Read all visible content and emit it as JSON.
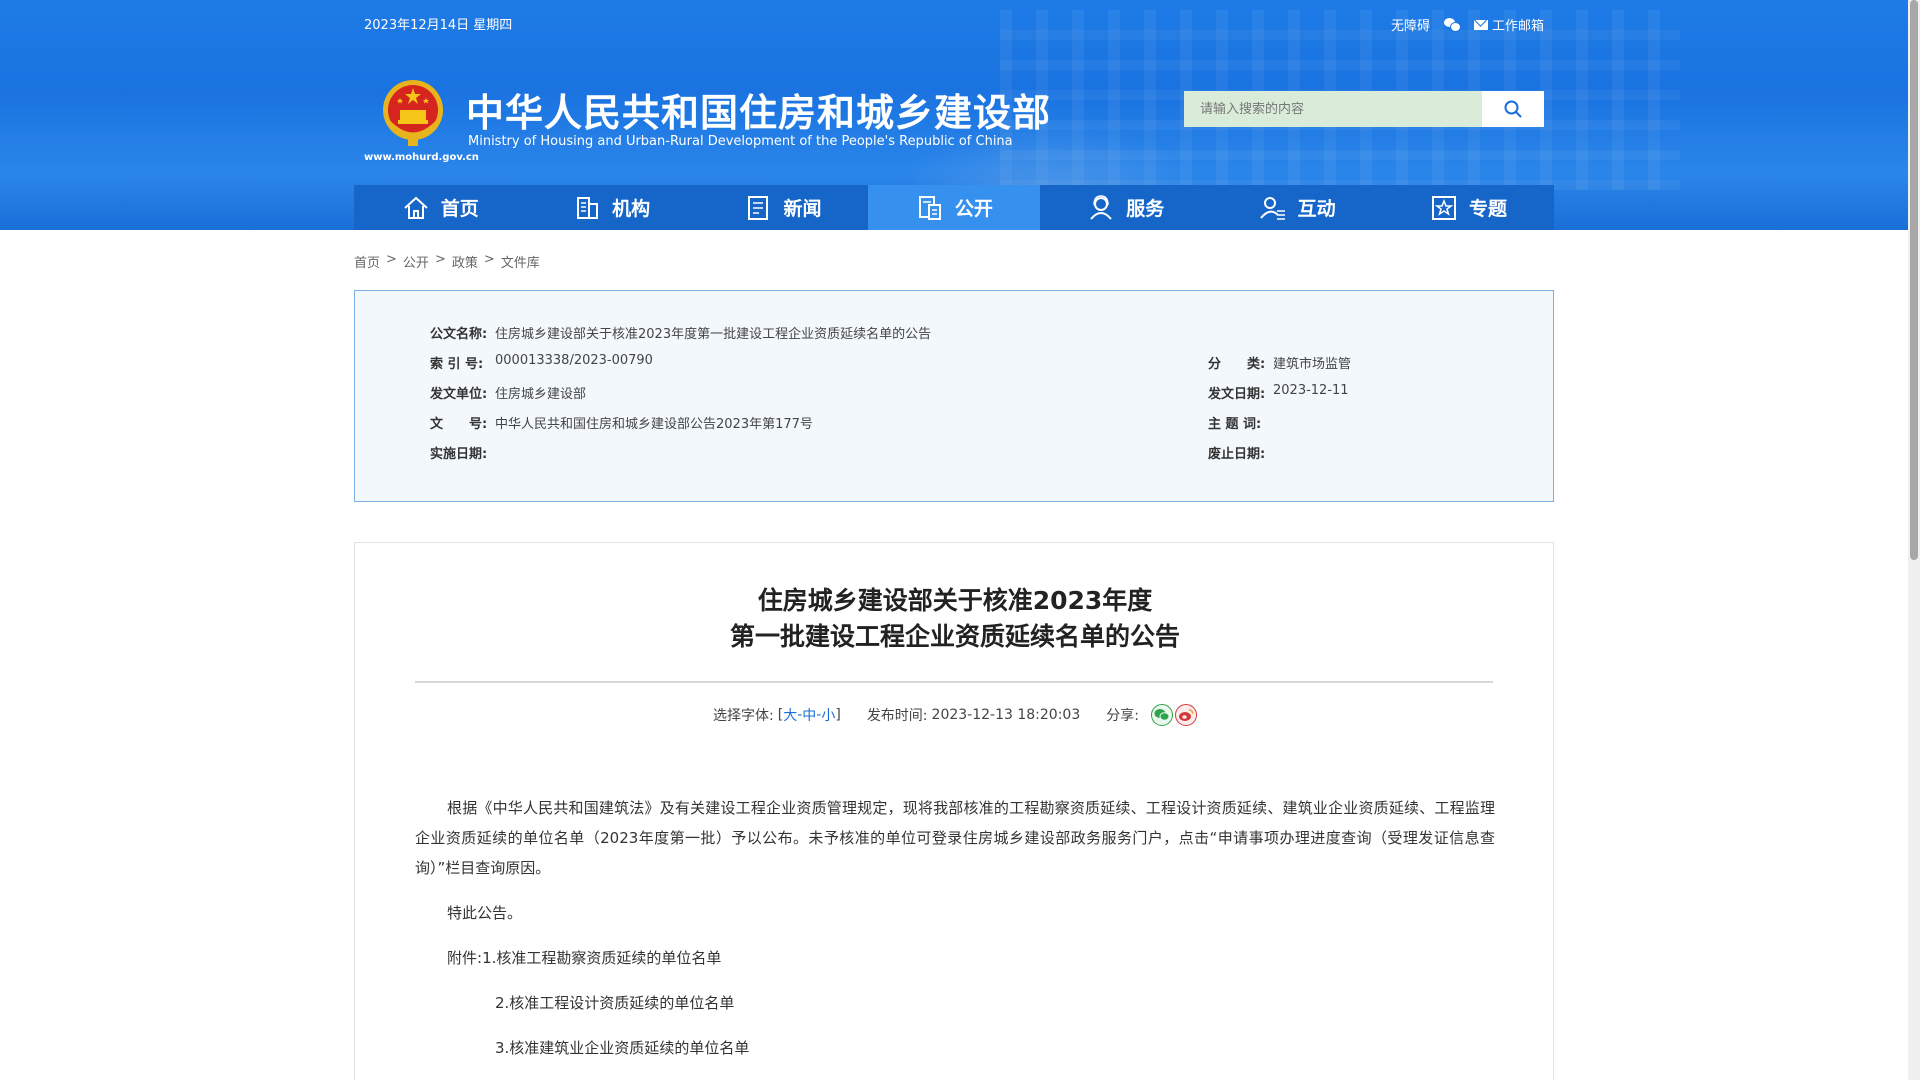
{
  "topbar": {
    "date": "2023年12月14日 星期四",
    "accessibility": "无障碍",
    "work_mail": "工作邮箱"
  },
  "site": {
    "title_cn": "中华人民共和国住房和城乡建设部",
    "title_en": "Ministry of Housing and Urban-Rural Development of the People's Republic of China",
    "url": "www.mohurd.gov.cn"
  },
  "search": {
    "placeholder": "请输入搜索的内容"
  },
  "nav": {
    "items": [
      {
        "label": "首页",
        "icon": "home-icon"
      },
      {
        "label": "机构",
        "icon": "building-icon"
      },
      {
        "label": "新闻",
        "icon": "news-icon"
      },
      {
        "label": "公开",
        "icon": "disclosure-icon"
      },
      {
        "label": "服务",
        "icon": "service-icon"
      },
      {
        "label": "互动",
        "icon": "interaction-icon"
      },
      {
        "label": "专题",
        "icon": "topic-icon"
      }
    ],
    "active": "公开"
  },
  "breadcrumb": {
    "items": [
      "首页",
      "公开",
      "政策",
      "文件库"
    ],
    "sep": ">"
  },
  "info": {
    "doc_name_label": "公文名称:",
    "doc_name": "住房城乡建设部关于核准2023年度第一批建设工程企业资质延续名单的公告",
    "index_label": "索 引 号:",
    "index": "000013338/2023-00790",
    "category_label": "分　　类:",
    "category": "建筑市场监管",
    "issuer_label": "发文单位:",
    "issuer": "住房城乡建设部",
    "issue_date_label": "发文日期:",
    "issue_date": "2023-12-11",
    "doc_no_label": "文　　号:",
    "doc_no": "中华人民共和国住房和城乡建设部公告2023年第177号",
    "subject_label": "主 题 词:",
    "subject": "",
    "effective_label": "实施日期:",
    "effective": "",
    "expiry_label": "废止日期:",
    "expiry": ""
  },
  "article": {
    "title_line1": "住房城乡建设部关于核准2023年度",
    "title_line2": "第一批建设工程企业资质延续名单的公告",
    "font_label": "选择字体:",
    "bracket_open": "[",
    "font_large": "大",
    "font_medium": "中",
    "font_small": "小",
    "bracket_close": "]",
    "dash": "-",
    "publish_label": "发布时间:",
    "publish_time": "2023-12-13 18:20:03",
    "share_label": "分享:",
    "para1": "根据《中华人民共和国建筑法》及有关建设工程企业资质管理规定，现将我部核准的工程勘察资质延续、工程设计资质延续、建筑业企业资质延续、工程监理企业资质延续的单位名单（2023年度第一批）予以公布。未予核准的单位可登录住房城乡建设部政务服务门户，点击“申请事项办理进度查询（受理发证信息查询）”栏目查询原因。",
    "para2": "特此公告。",
    "attach_label": "附件:",
    "attach1": "1.核准工程勘察资质延续的单位名单",
    "attach2": "2.核准工程设计资质延续的单位名单",
    "attach3": "3.核准建筑业企业资质延续的单位名单"
  },
  "colors": {
    "header_blue": "#1a73e0",
    "nav_blue": "#1665c8",
    "nav_active": "#3590ee",
    "panel_bg": "#f3f8fd",
    "panel_border": "#7ab0e6",
    "link_blue": "#1a6ed8"
  }
}
